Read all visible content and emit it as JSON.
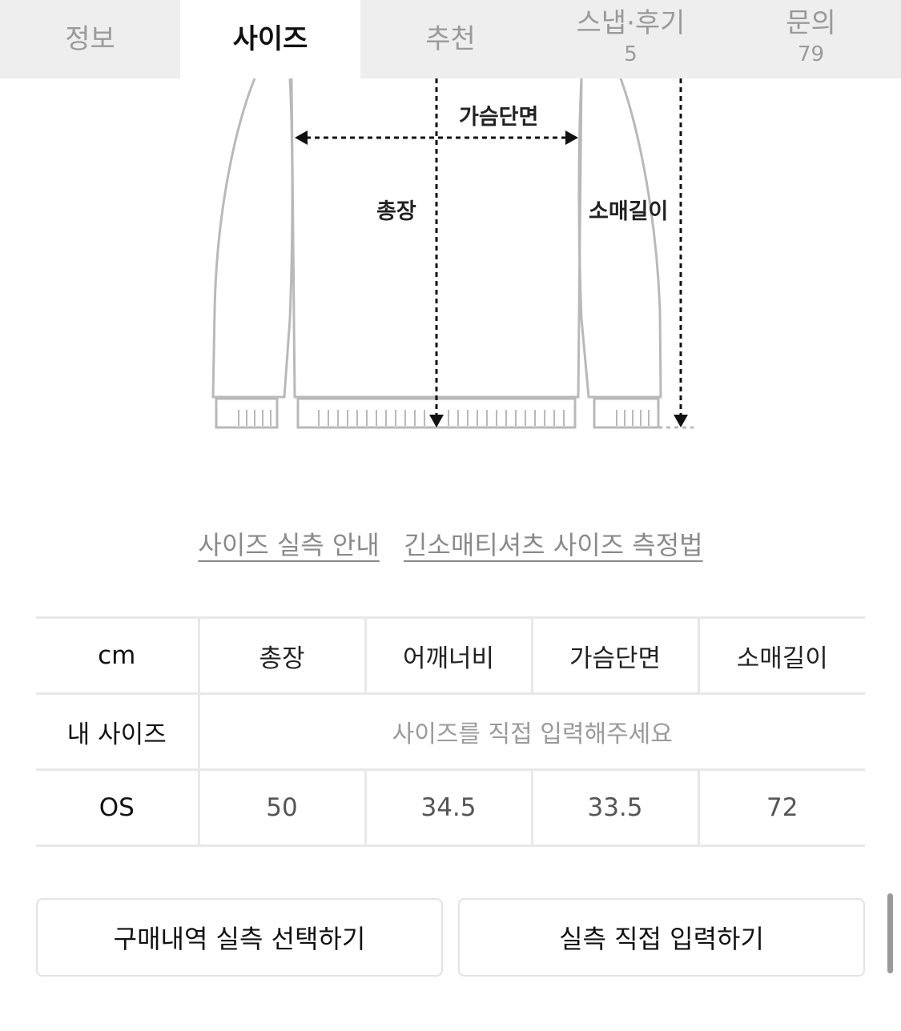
{
  "tabs": [
    {
      "label": "정보",
      "count": ""
    },
    {
      "label": "사이즈",
      "count": ""
    },
    {
      "label": "추천",
      "count": ""
    },
    {
      "label": "스냅·후기",
      "count": "5"
    },
    {
      "label": "문의",
      "count": "79"
    }
  ],
  "active_tab": 1,
  "diagram": {
    "chest_width": "가슴단면",
    "total_length": "총장",
    "sleeve_length": "소매길이"
  },
  "links": {
    "size_guide": "사이즈 실측 안내",
    "measure_method": "긴소매티셔츠 사이즈 측정법"
  },
  "size_table": {
    "unit_header": "cm",
    "columns": [
      "총장",
      "어깨너비",
      "가슴단면",
      "소매길이"
    ],
    "my_size": {
      "label": "내 사이즈",
      "placeholder": "사이즈를 직접 입력해주세요"
    },
    "rows": [
      {
        "size": "OS",
        "values": [
          "50",
          "34.5",
          "33.5",
          "72"
        ]
      }
    ]
  },
  "buttons": {
    "select_from_purchase": "구매내역 실측 선택하기",
    "enter_directly": "실측 직접 입력하기"
  }
}
